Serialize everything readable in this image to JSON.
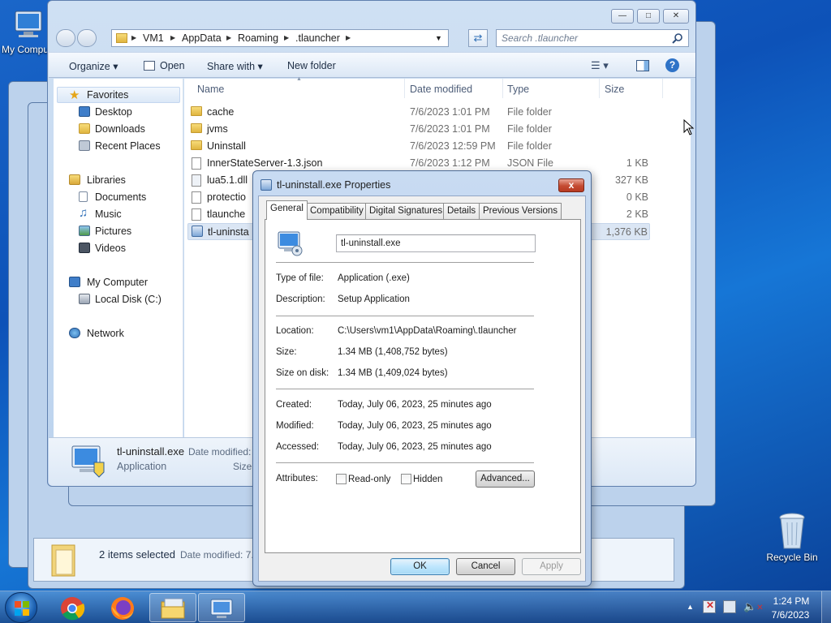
{
  "desktop": {
    "my_computer_label": "My Compu",
    "recycle_bin_label": "Recycle Bin"
  },
  "explorer": {
    "breadcrumb": [
      "VM1",
      "AppData",
      "Roaming",
      ".tlauncher"
    ],
    "search_placeholder": "Search .tlauncher",
    "toolbar": {
      "organize": "Organize",
      "open": "Open",
      "share_with": "Share with",
      "new_folder": "New folder"
    },
    "nav": {
      "favorites": "Favorites",
      "desktop": "Desktop",
      "downloads": "Downloads",
      "recent_places": "Recent Places",
      "libraries": "Libraries",
      "documents": "Documents",
      "music": "Music",
      "pictures": "Pictures",
      "videos": "Videos",
      "my_computer": "My Computer",
      "local_disk": "Local Disk (C:)",
      "network": "Network"
    },
    "columns": {
      "name": "Name",
      "date": "Date modified",
      "type": "Type",
      "size": "Size"
    },
    "files": [
      {
        "name": "cache",
        "date": "7/6/2023 1:01 PM",
        "type": "File folder",
        "size": ""
      },
      {
        "name": "jvms",
        "date": "7/6/2023 1:01 PM",
        "type": "File folder",
        "size": ""
      },
      {
        "name": "Uninstall",
        "date": "7/6/2023 12:59 PM",
        "type": "File folder",
        "size": ""
      },
      {
        "name": "InnerStateServer-1.3.json",
        "date": "7/6/2023 1:12 PM",
        "type": "JSON File",
        "size": "1 KB"
      },
      {
        "name": "lua5.1.dll",
        "date": "",
        "type": "",
        "size": "327 KB"
      },
      {
        "name": "protectio",
        "date": "",
        "type": "",
        "size": "0 KB"
      },
      {
        "name": "tlaunche",
        "date": "",
        "type": "",
        "size": "2 KB"
      },
      {
        "name": "tl-uninsta",
        "date": "",
        "type": "",
        "size": "1,376 KB"
      }
    ],
    "details": {
      "name": "tl-uninstall.exe",
      "date_label": "Date modified:",
      "type": "Application",
      "size_label": "Size:"
    }
  },
  "bg_window": {
    "status": "2 items selected",
    "date_label": "Date modified: 7."
  },
  "dialog": {
    "title": "tl-uninstall.exe Properties",
    "close": "x",
    "tabs": [
      "General",
      "Compatibility",
      "Digital Signatures",
      "Details",
      "Previous Versions"
    ],
    "filename": "tl-uninstall.exe",
    "type_label": "Type of file:",
    "type_value": "Application (.exe)",
    "desc_label": "Description:",
    "desc_value": "Setup Application",
    "location_label": "Location:",
    "location_value": "C:\\Users\\vm1\\AppData\\Roaming\\.tlauncher",
    "size_label": "Size:",
    "size_value": "1.34 MB (1,408,752 bytes)",
    "size_disk_label": "Size on disk:",
    "size_disk_value": "1.34 MB (1,409,024 bytes)",
    "created_label": "Created:",
    "created_value": "Today, July 06, 2023, 25 minutes ago",
    "modified_label": "Modified:",
    "modified_value": "Today, July 06, 2023, 25 minutes ago",
    "accessed_label": "Accessed:",
    "accessed_value": "Today, July 06, 2023, 25 minutes ago",
    "attributes_label": "Attributes:",
    "readonly_label": "Read-only",
    "hidden_label": "Hidden",
    "advanced_button": "Advanced...",
    "ok_button": "OK",
    "cancel_button": "Cancel",
    "apply_button": "Apply"
  },
  "tray": {
    "time": "1:24 PM",
    "date": "7/6/2023"
  },
  "colors": {
    "desktop_blue": "#1565c8",
    "close_red": "#c44a32",
    "default_button": "#bee6fd"
  }
}
